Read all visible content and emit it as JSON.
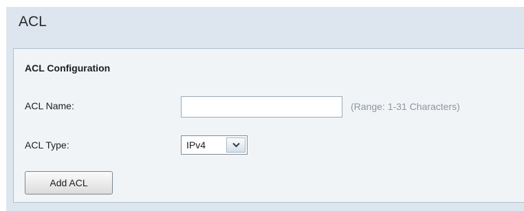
{
  "page": {
    "title": "ACL"
  },
  "config": {
    "section_title": "ACL Configuration",
    "name_label": "ACL Name:",
    "name_value": "",
    "name_hint": "(Range: 1-31 Characters)",
    "type_label": "ACL Type:",
    "type_selected": "IPv4",
    "type_arrow_icon": "chevron-down-icon",
    "add_button_label": "Add ACL"
  },
  "colors": {
    "page_background": "#dde6ee",
    "panel_background": "#f1f4f7",
    "panel_border": "#aebfce",
    "hint_text": "#8f969c"
  }
}
